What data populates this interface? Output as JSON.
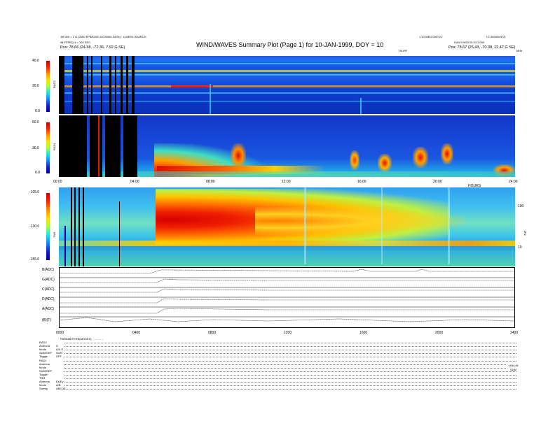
{
  "header": {
    "line_left_1": "1st 000 = 1 O (2000 EP/MODE 0/C00000 DATA) · 4 WEEK SEARCH",
    "line_left_2": "All FFREQ 3 = 120 SEC",
    "pos_left": "Pos: 78.66 (24.38, -72.36, 7.92 G SE)",
    "title": "WIND/WAVES Summary Plot (Page 1) for 10-JAN-1999, DOY = 10",
    "right_1": "1.10 WED 00/FOC",
    "right_2": "LZ 00/DB/v4.01",
    "right_3": "DAILY BGD 00.03 3.000",
    "pos_right": "Pos: 78.67 (25.43, -70.38, 12.47 G SE)",
    "tsurf": "TSURF",
    "mhz": "MHz"
  },
  "rad2": {
    "label": "RAD2",
    "ticks": [
      "40.0",
      "20.0",
      "0.0"
    ]
  },
  "rad1": {
    "label": "RAD1",
    "ticks": [
      "50.0",
      "30.0",
      "0.0"
    ]
  },
  "time_axis_1": {
    "ticks": [
      "00:00",
      "04:00",
      "08:00",
      "12:00",
      "16:00",
      "20:00",
      "24:00"
    ],
    "unit_label": "HOURS"
  },
  "tnr": {
    "label": "TNR",
    "ticks": [
      "-105.0",
      "-130.0",
      "-155.0"
    ],
    "right_ticks": [
      "100",
      "10"
    ],
    "right_unit": "kHz"
  },
  "line_panels": [
    {
      "label": "B(ADC)"
    },
    {
      "label": "G(ADC)"
    },
    {
      "label": "C(ADC)"
    },
    {
      "label": "D(ADC)"
    },
    {
      "label": "A(ADC)"
    },
    {
      "label": "(B)(T)"
    }
  ],
  "time_axis_2": {
    "ticks": [
      "0000",
      "0400",
      "0800",
      "1200",
      "1600",
      "2000",
      "2400"
    ]
  },
  "params_header": "PARAMETERS(MODES) ... ... ... ...",
  "params": [
    {
      "label": "RAD2",
      "value": ""
    },
    {
      "label": "Antenna",
      "value": "S"
    },
    {
      "label": "Mode",
      "value": "LIN S"
    },
    {
      "label": "SUM/SEP",
      "value": "SUM"
    },
    {
      "label": "Toggle",
      "value": "OFF"
    },
    {
      "label": "RAD1",
      "value": ""
    },
    {
      "label": "Antenna",
      "value": ""
    },
    {
      "label": "Mode",
      "value": ""
    },
    {
      "label": "SUM/SEP",
      "value": ""
    },
    {
      "label": "Toggle",
      "value": ""
    },
    {
      "label": "TNR",
      "value": ""
    },
    {
      "label": "Antenna",
      "value": "Ex/Ey"
    },
    {
      "label": "Mode",
      "value": "A/B"
    },
    {
      "label": "Sweep",
      "value": "ABCDE"
    }
  ],
  "params_right": [
    "LIN/LIN",
    "SUM"
  ],
  "colors": {
    "background": "#ffffff",
    "spectrum_low": "#1540d8",
    "spectrum_high": "#e81000"
  }
}
